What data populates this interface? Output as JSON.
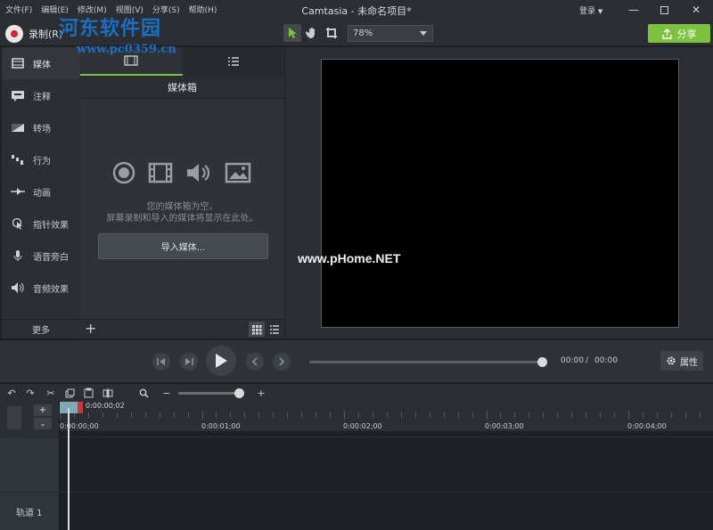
{
  "app": {
    "title": "Camtasia - 未命名项目*"
  },
  "menu": [
    {
      "label": "文件(F)"
    },
    {
      "label": "编辑(E)"
    },
    {
      "label": "修改(M)"
    },
    {
      "label": "视图(V)"
    },
    {
      "label": "分享(S)"
    },
    {
      "label": "帮助(H)"
    }
  ],
  "account": {
    "login_label": "登录"
  },
  "toolbar": {
    "record_label": "录制(R)",
    "zoom_value": "78%",
    "share_label": "分享"
  },
  "sidebar": {
    "items": [
      {
        "label": "媒体",
        "icon": "media-icon"
      },
      {
        "label": "注释",
        "icon": "annotation-icon"
      },
      {
        "label": "转场",
        "icon": "transition-icon"
      },
      {
        "label": "行为",
        "icon": "behavior-icon"
      },
      {
        "label": "动画",
        "icon": "animation-icon"
      },
      {
        "label": "指针效果",
        "icon": "cursor-effect-icon"
      },
      {
        "label": "语音旁白",
        "icon": "microphone-icon"
      },
      {
        "label": "音频效果",
        "icon": "speaker-icon"
      }
    ],
    "more_label": "更多"
  },
  "media_bin": {
    "title": "媒体箱",
    "empty_line1": "您的媒体箱为空。",
    "empty_line2": "屏幕录制和导入的媒体将显示在此处。",
    "import_label": "导入媒体..."
  },
  "playback": {
    "current_time": "00:00",
    "separator": "/",
    "total_time": "00:00",
    "properties_label": "属性"
  },
  "timeline": {
    "playhead_time": "0:00:00;02",
    "ruler_labels": [
      "0:00:00;00",
      "0:00:01;00",
      "0:00:02;00",
      "0:00:03;00",
      "0:00:04;00"
    ],
    "track_name": "轨道 1"
  },
  "watermarks": {
    "site_name": "河东软件园",
    "site_url": "www.pc0359.cn",
    "center_text": "www.pHome.NET"
  },
  "colors": {
    "accent": "#7cc13f",
    "record": "#d9262c",
    "playhead": "#7faab3"
  }
}
